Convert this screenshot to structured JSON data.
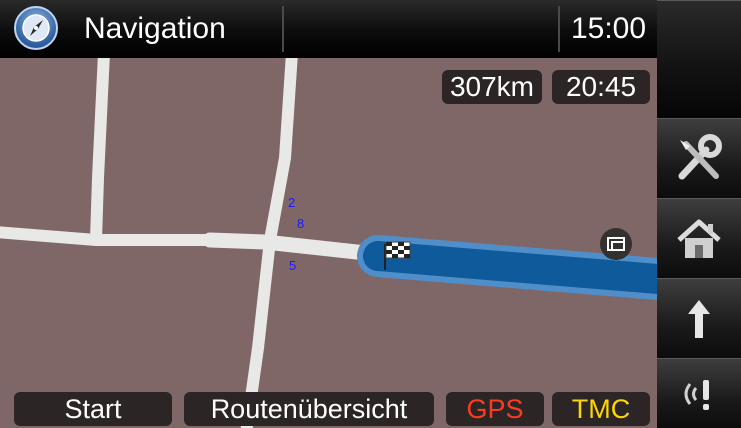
{
  "header": {
    "title": "Navigation",
    "time": "15:00",
    "icon": "compass-icon"
  },
  "info": {
    "distance": "307km",
    "arrival": "20:45"
  },
  "map": {
    "road_labels": [
      "2",
      "8",
      "5"
    ],
    "destination_icon": "checkered-flag-icon",
    "view_toggle_icon": "map-view-icon",
    "colors": {
      "background": "#7f6767",
      "road": "#e8e8e6",
      "route": "#0f5a9a",
      "route_outline": "#4f8ec9"
    }
  },
  "bottom_bar": {
    "start_label": "Start",
    "route_overview_label": "Routenübersicht",
    "gps_label": "GPS",
    "tmc_label": "TMC",
    "gps_color": "#ff3b1f",
    "tmc_color": "#ffd400"
  },
  "sidebar": {
    "items": [
      {
        "icon": "tools-icon"
      },
      {
        "icon": "home-icon"
      },
      {
        "icon": "arrow-up-icon"
      },
      {
        "icon": "traffic-alert-icon"
      }
    ]
  }
}
